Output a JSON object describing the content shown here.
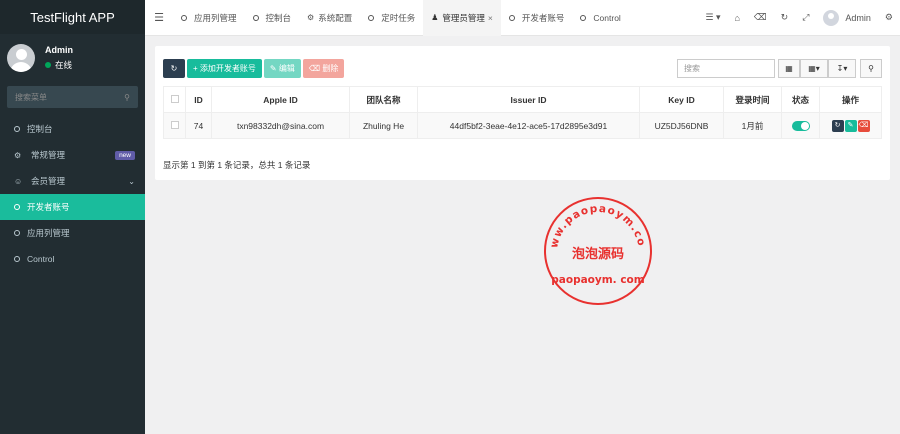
{
  "brand": "TestFlight APP",
  "user": {
    "name": "Admin",
    "status": "在线"
  },
  "sidebar": {
    "search_placeholder": "搜索菜单",
    "items": [
      {
        "label": "控制台",
        "icon": "circle-icon"
      },
      {
        "label": "常规管理",
        "icon": "gears-icon",
        "badge": "new"
      },
      {
        "label": "会员管理",
        "icon": "user-circle-icon"
      },
      {
        "label": "开发者账号",
        "icon": "circle-icon",
        "active": true
      },
      {
        "label": "应用列管理",
        "icon": "circle-icon"
      },
      {
        "label": "Control",
        "icon": "circle-icon"
      }
    ]
  },
  "topbar": {
    "tabs": [
      {
        "label": "应用列管理",
        "icon": "circle-icon"
      },
      {
        "label": "控制台",
        "icon": "circle-icon"
      },
      {
        "label": "系统配置",
        "icon": "gear-icon"
      },
      {
        "label": "定时任务",
        "icon": "circle-icon"
      },
      {
        "label": "管理员管理",
        "icon": "user-icon",
        "active": true,
        "close": "×"
      },
      {
        "label": "开发者账号",
        "icon": "circle-icon"
      },
      {
        "label": "Control",
        "icon": "circle-icon"
      }
    ],
    "user_name": "Admin"
  },
  "toolbar": {
    "add_label": "添加开发者账号",
    "edit_label": "编辑",
    "delete_label": "删除",
    "search_placeholder": "搜索"
  },
  "table": {
    "headers": [
      "ID",
      "Apple ID",
      "团队名称",
      "Issuer ID",
      "Key ID",
      "登录时间",
      "状态",
      "操作"
    ],
    "rows": [
      {
        "id": "74",
        "apple_id": "txn98332dh@sina.com",
        "team": "Zhuling He",
        "issuer_id": "44df5bf2-3eae-4e12-ace5-17d2895e3d91",
        "key_id": "UZ5DJ56DNB",
        "login_time": "1月前",
        "status_on": true
      }
    ]
  },
  "pager_text": "显示第 1 到第 1 条记录，总共 1 条记录",
  "watermark": {
    "arc_text": "www.paopaoym.com",
    "center_text": "泡泡源码",
    "bottom_text": "paopaoym. com",
    "color": "#e8312f"
  },
  "colors": {
    "sidebar_bg": "#222d32",
    "accent": "#18bc9c",
    "dark_btn": "#2c3e50",
    "danger": "#e74c3c"
  }
}
